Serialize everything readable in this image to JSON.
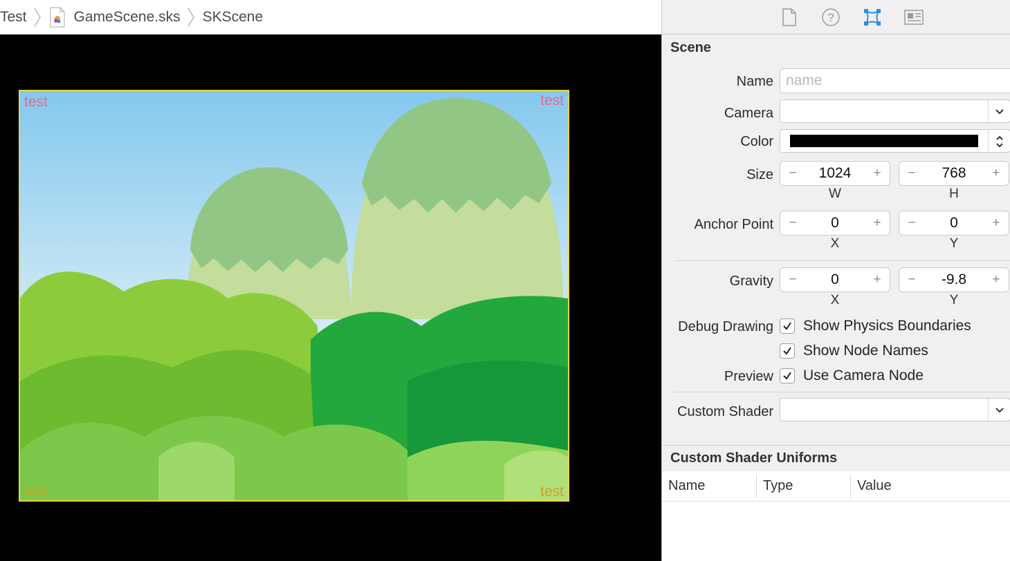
{
  "breadcrumb": {
    "items": [
      "Test",
      "GameScene.sks",
      "SKScene"
    ]
  },
  "scene_preview": {
    "corner_labels": [
      "test",
      "test",
      "test",
      "test"
    ]
  },
  "inspector": {
    "tabs": [
      "file-inspector-icon",
      "quick-help-icon",
      "attributes-inspector-icon",
      "library-icon"
    ],
    "section_title": "Scene",
    "name": {
      "label": "Name",
      "value": "",
      "placeholder": "name"
    },
    "camera": {
      "label": "Camera",
      "value": ""
    },
    "color": {
      "label": "Color",
      "swatch": "#000000"
    },
    "size": {
      "label": "Size",
      "w": "1024",
      "h": "768",
      "w_label": "W",
      "h_label": "H"
    },
    "anchor": {
      "label": "Anchor Point",
      "x": "0",
      "y": "0",
      "x_label": "X",
      "y_label": "Y"
    },
    "gravity": {
      "label": "Gravity",
      "x": "0",
      "y": "-9.8",
      "x_label": "X",
      "y_label": "Y"
    },
    "debug": {
      "label": "Debug Drawing",
      "physics": "Show Physics Boundaries",
      "node_names": "Show Node Names"
    },
    "preview": {
      "label": "Preview",
      "camera_node": "Use Camera Node"
    },
    "shader": {
      "label": "Custom Shader",
      "value": ""
    },
    "uniforms": {
      "title": "Custom Shader Uniforms",
      "columns": [
        "Name",
        "Type",
        "Value"
      ]
    },
    "stepper_minus": "−",
    "stepper_plus": "+"
  },
  "colors": {
    "accent": "#2f8fe0",
    "scene_border": "#e8d44a",
    "sky_top": "#84c8ee",
    "sky_bottom": "#d6ecf6"
  }
}
